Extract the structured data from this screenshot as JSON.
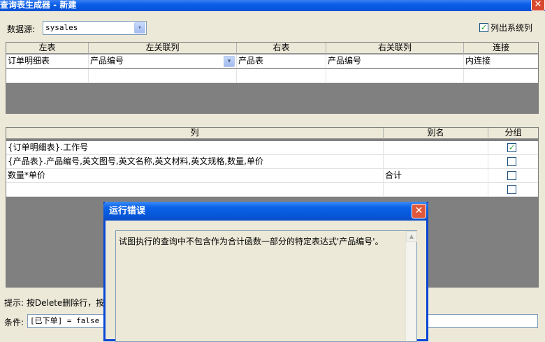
{
  "window": {
    "title": "查询表生成器 - 新建",
    "close_glyph": "✕"
  },
  "datasource": {
    "label": "数据源:",
    "value": "sysales",
    "dropdown_glyph": "▾"
  },
  "show_system_columns": {
    "label": "列出系统列",
    "checked": true
  },
  "join_table": {
    "headers": [
      "左表",
      "左关联列",
      "右表",
      "右关联列",
      "连接"
    ],
    "rows": [
      [
        "订单明细表",
        "产品编号",
        "产品表",
        "产品编号",
        "内连接"
      ],
      [
        "",
        "",
        "",
        "",
        ""
      ]
    ],
    "dropdown_glyph": "▾"
  },
  "column_table": {
    "headers": [
      "列",
      "别名",
      "分组"
    ],
    "rows": [
      {
        "column": "{订单明细表}.工作号",
        "alias": "",
        "group": true
      },
      {
        "column": "{产品表}.产品编号,英文图号,英文名称,英文材料,英文规格,数量,单价",
        "alias": "",
        "group": false
      },
      {
        "column": "数量*单价",
        "alias": "合计",
        "group": false
      },
      {
        "column": "",
        "alias": "",
        "group": false
      }
    ]
  },
  "hint": {
    "text": "提示: 按Delete删除行，按"
  },
  "condition": {
    "label": "条件:",
    "value": "[已下单] = false"
  },
  "error_dialog": {
    "title": "运行错误",
    "close_glyph": "✕",
    "message": "试图执行的查询中不包含作为合计函数一部分的特定表达式'产品编号'。",
    "scroll_up_glyph": "▲"
  }
}
